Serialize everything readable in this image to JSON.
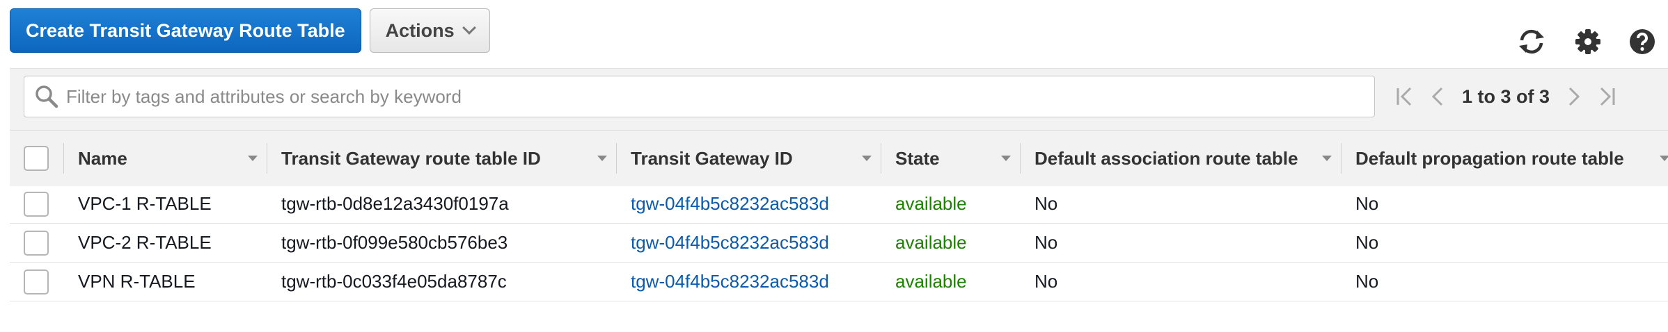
{
  "toolbar": {
    "create_label": "Create Transit Gateway Route Table",
    "actions_label": "Actions"
  },
  "icons": {
    "refresh": "refresh-icon",
    "settings": "gear-icon",
    "help": "help-icon",
    "search": "search-icon"
  },
  "search": {
    "placeholder": "Filter by tags and attributes or search by keyword",
    "value": ""
  },
  "pagination": {
    "text": "1 to 3 of 3"
  },
  "table": {
    "columns": [
      "Name",
      "Transit Gateway route table ID",
      "Transit Gateway ID",
      "State",
      "Default association route table",
      "Default propagation route table"
    ],
    "rows": [
      {
        "name": "VPC-1 R-TABLE",
        "rtb_id": "tgw-rtb-0d8e12a3430f0197a",
        "tgw_id": "tgw-04f4b5c8232ac583d",
        "state": "available",
        "assoc": "No",
        "prop": "No"
      },
      {
        "name": "VPC-2 R-TABLE",
        "rtb_id": "tgw-rtb-0f099e580cb576be3",
        "tgw_id": "tgw-04f4b5c8232ac583d",
        "state": "available",
        "assoc": "No",
        "prop": "No"
      },
      {
        "name": "VPN R-TABLE",
        "rtb_id": "tgw-rtb-0c033f4e05da8787c",
        "tgw_id": "tgw-04f4b5c8232ac583d",
        "state": "available",
        "assoc": "No",
        "prop": "No"
      }
    ]
  },
  "colors": {
    "primary": "#0d66be",
    "link": "#0b5aad",
    "available": "#1d8102"
  }
}
